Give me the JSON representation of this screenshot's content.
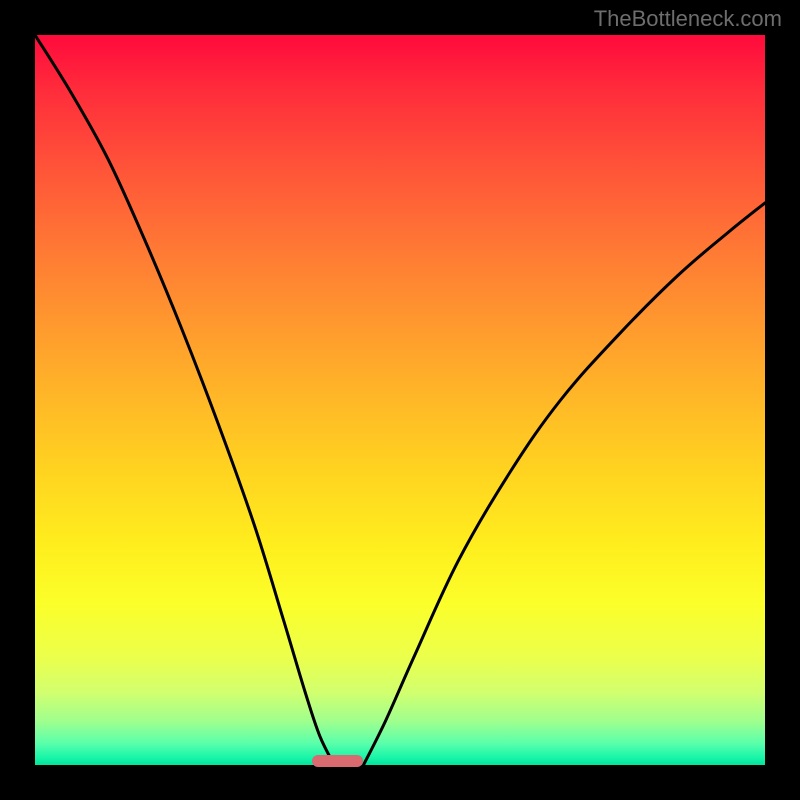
{
  "watermark": "TheBottleneck.com",
  "colors": {
    "background": "#000000",
    "gradient_top": "#ff0a3c",
    "gradient_bottom": "#00e49a",
    "curve": "#000000",
    "marker": "#d96a6f"
  },
  "chart_data": {
    "type": "line",
    "title": "",
    "xlabel": "",
    "ylabel": "",
    "xlim": [
      0,
      100
    ],
    "ylim": [
      0,
      100
    ],
    "x_optimal_range": [
      38,
      45
    ],
    "series": [
      {
        "name": "left-curve",
        "x": [
          0,
          5,
          10,
          15,
          20,
          25,
          30,
          34,
          37,
          39,
          41
        ],
        "y": [
          100,
          92,
          83,
          72,
          60,
          47,
          33,
          20,
          10,
          4,
          0
        ]
      },
      {
        "name": "right-curve",
        "x": [
          45,
          48,
          52,
          58,
          65,
          72,
          80,
          88,
          95,
          100
        ],
        "y": [
          0,
          6,
          15,
          28,
          40,
          50,
          59,
          67,
          73,
          77
        ]
      }
    ],
    "annotations": [
      {
        "type": "marker",
        "shape": "rounded-rect",
        "x_range": [
          38,
          45
        ],
        "y": 0
      }
    ]
  }
}
